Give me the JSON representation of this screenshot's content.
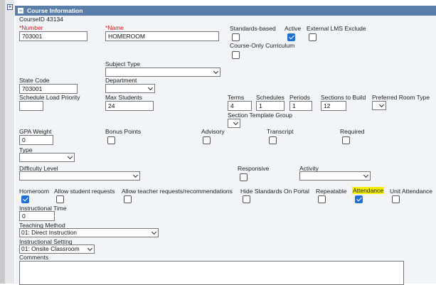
{
  "header": {
    "title": "Course Information"
  },
  "course_id": "CourseID 43134",
  "fields": {
    "number": {
      "label": "*Number",
      "value": "703001"
    },
    "name": {
      "label": "*Name",
      "value": "HOMEROOM"
    },
    "standards_based": {
      "label": "Standards-based",
      "checked": false
    },
    "active": {
      "label": "Active",
      "checked": true
    },
    "external_lms_exclude": {
      "label": "External LMS Exclude",
      "checked": false
    },
    "course_only_curriculum": {
      "label": "Course-Only Curriculum",
      "checked": false
    },
    "subject_type": {
      "label": "Subject Type",
      "value": ""
    },
    "state_code": {
      "label": "State Code",
      "value": "703001"
    },
    "department": {
      "label": "Department",
      "value": ""
    },
    "schedule_load_priority": {
      "label": "Schedule Load Priority",
      "value": ""
    },
    "max_students": {
      "label": "Max Students",
      "value": "24"
    },
    "terms": {
      "label": "Terms",
      "value": "4"
    },
    "schedules": {
      "label": "Schedules",
      "value": "1"
    },
    "periods": {
      "label": "Periods",
      "value": "1"
    },
    "sections_to_build": {
      "label": "Sections to Build",
      "value": "12"
    },
    "preferred_room_type": {
      "label": "Preferred Room Type",
      "value": ""
    },
    "section_template_group": {
      "label": "Section Template Group",
      "value": ""
    },
    "gpa_weight": {
      "label": "GPA Weight",
      "value": "0"
    },
    "bonus_points": {
      "label": "Bonus Points",
      "checked": false
    },
    "advisory": {
      "label": "Advisory",
      "checked": false
    },
    "transcript": {
      "label": "Transcript",
      "checked": false
    },
    "required": {
      "label": "Required",
      "checked": false
    },
    "type": {
      "label": "Type",
      "value": ""
    },
    "difficulty_level": {
      "label": "Difficulty Level",
      "value": ""
    },
    "responsive": {
      "label": "Responsive",
      "checked": false
    },
    "activity": {
      "label": "Activity",
      "value": ""
    },
    "homeroom": {
      "label": "Homeroom",
      "checked": true
    },
    "allow_student_requests": {
      "label": "Allow student requests",
      "checked": false
    },
    "allow_teacher_requests": {
      "label": "Allow teacher requests/recommendations",
      "checked": false
    },
    "hide_standards_on_portal": {
      "label": "Hide Standards On Portal",
      "checked": false
    },
    "repeatable": {
      "label": "Repeatable",
      "checked": false
    },
    "attendance": {
      "label": "Attendance",
      "checked": true,
      "highlight_color": "#f5ef00"
    },
    "unit_attendance": {
      "label": "Unit Attendance",
      "checked": false
    },
    "instructional_time": {
      "label": "Instructional Time",
      "value": "0"
    },
    "teaching_method": {
      "label": "Teaching Method",
      "value": "01: Direct Instruction"
    },
    "instructional_setting": {
      "label": "Instructional Setting",
      "value": "01: Onsite Classroom"
    },
    "comments": {
      "label": "Comments",
      "value": ""
    }
  },
  "colors": {
    "header_bg": "#5a7ea8",
    "checkbox_checked": "#1e70d6",
    "required_label": "#cc1f1f"
  }
}
